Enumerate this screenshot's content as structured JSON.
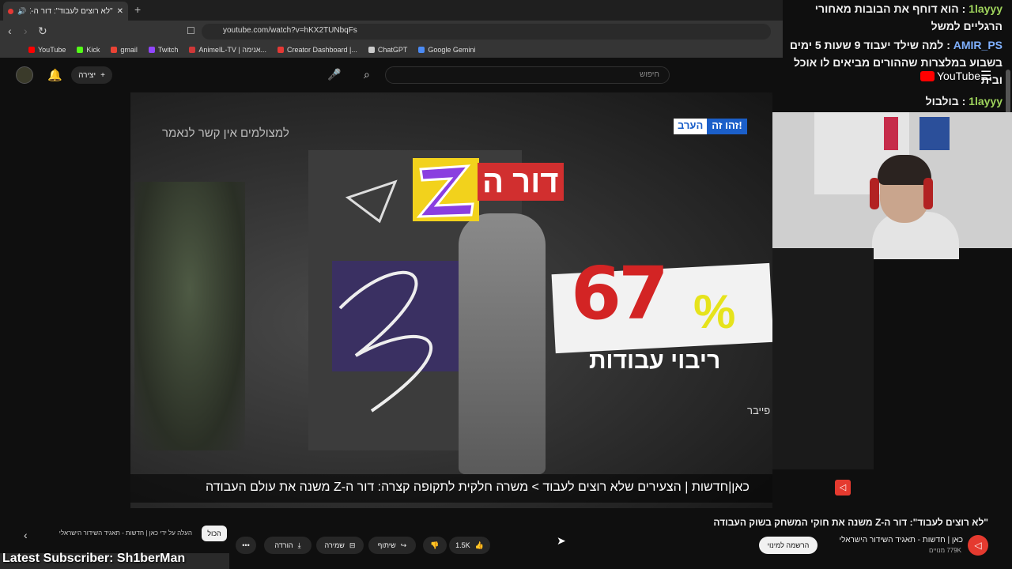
{
  "browser": {
    "tab_title": "\"לא רוצים לעבוד\": דור ה-Z מ...",
    "new_tab": "+",
    "url": "youtube.com/watch?v=hKX2TUNbqFs",
    "bookmarks": [
      {
        "label": "YouTube",
        "color": "#ff0000"
      },
      {
        "label": "Kick",
        "color": "#53fc18"
      },
      {
        "label": "gmail",
        "color": "#ea4335"
      },
      {
        "label": "Twitch",
        "color": "#9146ff"
      },
      {
        "label": "AnimeIL-TV | אנימה...",
        "color": "#d03838"
      },
      {
        "label": "Creator Dashboard |...",
        "color": "#e53935"
      },
      {
        "label": "ChatGPT",
        "color": "#cccccc"
      },
      {
        "label": "Google Gemini",
        "color": "#4b8bf5"
      }
    ]
  },
  "youtube": {
    "create_label": "יצירה",
    "search_placeholder": "חיפוש",
    "logo_text": "YouTube"
  },
  "video": {
    "top_left_caption": "למצולמים אין קשר לנאמר",
    "badge_blue": "זהו זה!",
    "badge_white": "הערב",
    "dor_text": "דור ה",
    "big_number": "67",
    "percent_sign": "%",
    "subtitle_big": "ריבוי עבודות",
    "source_note": "*נתונים: פייבר",
    "ticker": "כאן|חדשות   |   הצעירים שלא רוצים לעבוד  >  משרה חלקית לתקופה קצרה: דור ה-Z משנה את עולם העבודה"
  },
  "chat": [
    {
      "user": "1layyy",
      "text": "הוא דוחף את הבובות מאחורי הרגליים למשל"
    },
    {
      "user": "AMIR_PS",
      "text": "למה שילד יעבוד 9 שעות 5 ימים בשבוע במלצרות שההורים מביאים לו אוכל ובית"
    },
    {
      "user": "1layyy",
      "text": "בולבול"
    }
  ],
  "below": {
    "title": "\"לא רוצים לעבוד\": דור ה-Z משנה את חוקי המשחק בשוק העבודה",
    "channel": "כאן | חדשות - תאגיד השידור הישראלי",
    "subs": "779K מנויים",
    "subscribe": "הרשמה למינוי",
    "likes": "1.5K",
    "share": "שיתוף",
    "save": "שמירה",
    "download": "הורדה",
    "more": "•••",
    "uploaded_by": "העלה על ידי כאן | חדשות - תאגיד השידור הישראלי",
    "all_chip": "הכול"
  },
  "overlay": {
    "latest_subscriber": "Latest Subscriber: Sh1berMan"
  }
}
